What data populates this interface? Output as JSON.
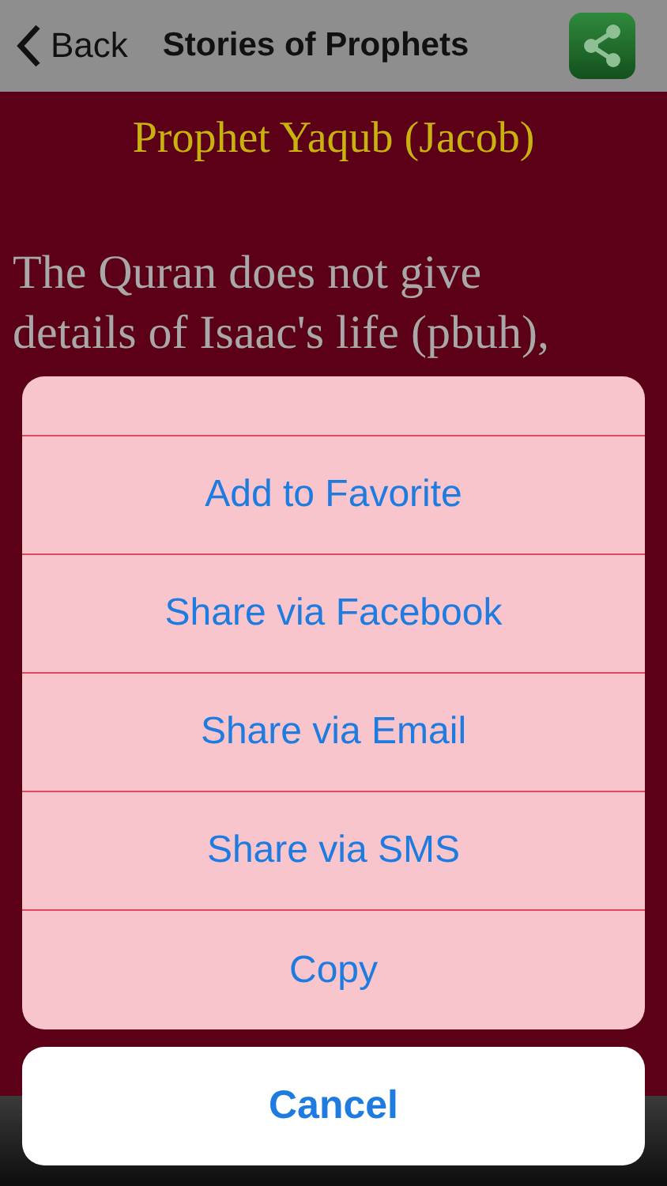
{
  "nav_bar": {
    "back": "Back",
    "title": "Stories of Prophets"
  },
  "article": {
    "title": "Prophet Yaqub (Jacob)",
    "body_lines": [
      "The Quran does not give",
      "details of Isaac's life (pbuh),"
    ]
  },
  "action_sheet": {
    "actions": [
      "Add to Favorite",
      "Share via Facebook",
      "Share via Email",
      "Share via SMS",
      "Copy"
    ],
    "cancel": "Cancel"
  }
}
